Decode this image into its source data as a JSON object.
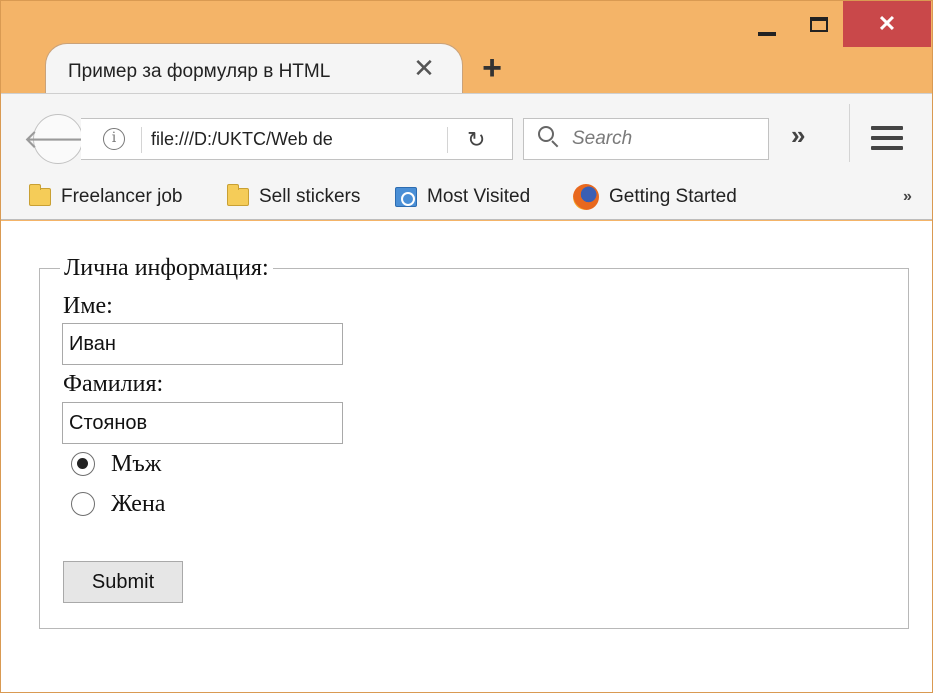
{
  "tab": {
    "title": "Пример за формуляр в HTML",
    "close_glyph": "✕",
    "new_tab_glyph": "+"
  },
  "window": {
    "close_glyph": "✕"
  },
  "nav": {
    "back_glyph": "🡐",
    "info_glyph": "i",
    "url": "file:///D:/UKTC/Web de",
    "reload_glyph": "↻",
    "search_placeholder": "Search",
    "overflow_glyph": "»"
  },
  "bookmarks": {
    "items": [
      {
        "label": "Freelancer job",
        "icon": "folder-icon"
      },
      {
        "label": "Sell stickers",
        "icon": "folder-icon"
      },
      {
        "label": "Most Visited",
        "icon": "most-visited-icon"
      },
      {
        "label": "Getting Started",
        "icon": "firefox-icon"
      }
    ],
    "overflow_glyph": "»"
  },
  "form": {
    "legend": "Лична информация:",
    "first_name_label": "Име:",
    "first_name_value": "Иван",
    "last_name_label": "Фамилия:",
    "last_name_value": "Стоянов",
    "gender_options": [
      {
        "label": "Мъж",
        "checked": true
      },
      {
        "label": "Жена",
        "checked": false
      }
    ],
    "submit_label": "Submit"
  }
}
